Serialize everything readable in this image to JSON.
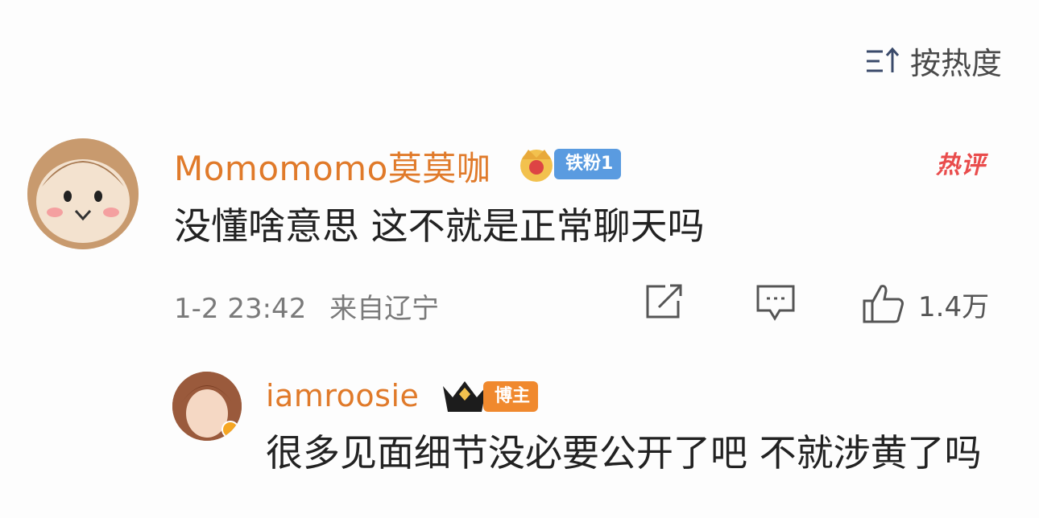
{
  "sort": {
    "label": "按热度",
    "icon": "sort-icon"
  },
  "comment": {
    "username": "Momomomo莫莫咖",
    "badge": "铁粉1",
    "hot_label": "热评",
    "text": "没懂啥意思 这不就是正常聊天吗",
    "time": "1-2 23:42",
    "location": "来自辽宁",
    "likes": "1.4万",
    "icons": [
      "share-icon",
      "comment-icon",
      "like-icon"
    ]
  },
  "reply": {
    "username": "iamroosie",
    "badge": "博主",
    "text": "很多见面细节没必要公开了吧 不就涉黄了吗"
  },
  "colors": {
    "username": "#e07a2a",
    "fan_badge": "#5a9be0",
    "blogger_badge": "#f0892e",
    "hot": "#e94c4c"
  }
}
